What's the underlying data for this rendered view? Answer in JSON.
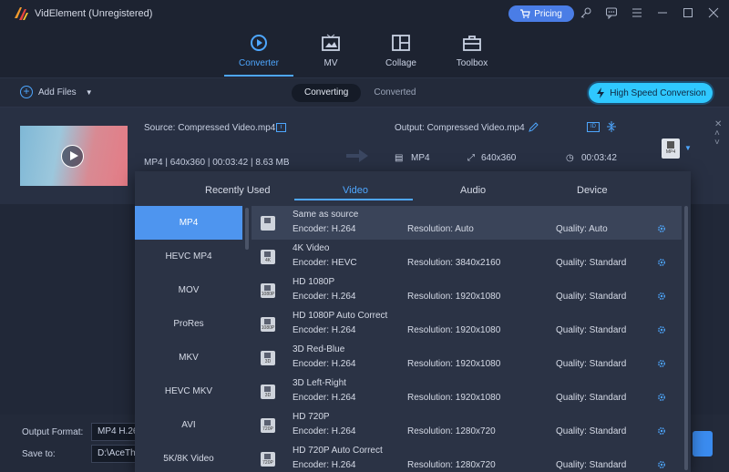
{
  "app": {
    "title": "VidElement (Unregistered)",
    "pricing_label": "Pricing"
  },
  "nav": {
    "tabs": [
      {
        "label": "Converter"
      },
      {
        "label": "MV"
      },
      {
        "label": "Collage"
      },
      {
        "label": "Toolbox"
      }
    ]
  },
  "toolbar": {
    "add_files": "Add Files",
    "converting": "Converting",
    "converted": "Converted",
    "hsc": "High Speed Conversion"
  },
  "file": {
    "source": "Source: Compressed Video.mp4",
    "source_meta": "MP4 | 640x360 | 00:03:42 | 8.63 MB",
    "output": "Output: Compressed Video.mp4",
    "out_format": "MP4",
    "out_res": "640x360",
    "out_duration": "00:03:42",
    "format_thumb": "MP4"
  },
  "panel": {
    "tabs": [
      "Recently Used",
      "Video",
      "Audio",
      "Device"
    ],
    "formats": [
      "MP4",
      "HEVC MP4",
      "MOV",
      "ProRes",
      "MKV",
      "HEVC MKV",
      "AVI",
      "5K/8K Video"
    ],
    "presets": [
      {
        "name": "Same as source",
        "encoder": "Encoder: H.264",
        "res": "Resolution: Auto",
        "quality": "Quality: Auto",
        "tag": ""
      },
      {
        "name": "4K Video",
        "encoder": "Encoder: HEVC",
        "res": "Resolution: 3840x2160",
        "quality": "Quality: Standard",
        "tag": "4K"
      },
      {
        "name": "HD 1080P",
        "encoder": "Encoder: H.264",
        "res": "Resolution: 1920x1080",
        "quality": "Quality: Standard",
        "tag": "1080P"
      },
      {
        "name": "HD 1080P Auto Correct",
        "encoder": "Encoder: H.264",
        "res": "Resolution: 1920x1080",
        "quality": "Quality: Standard",
        "tag": "1080P"
      },
      {
        "name": "3D Red-Blue",
        "encoder": "Encoder: H.264",
        "res": "Resolution: 1920x1080",
        "quality": "Quality: Standard",
        "tag": "3D"
      },
      {
        "name": "3D Left-Right",
        "encoder": "Encoder: H.264",
        "res": "Resolution: 1920x1080",
        "quality": "Quality: Standard",
        "tag": "3D"
      },
      {
        "name": "HD 720P",
        "encoder": "Encoder: H.264",
        "res": "Resolution: 1280x720",
        "quality": "Quality: Standard",
        "tag": "720P"
      },
      {
        "name": "HD 720P Auto Correct",
        "encoder": "Encoder: H.264",
        "res": "Resolution: 1280x720",
        "quality": "Quality: Standard",
        "tag": "720P"
      }
    ]
  },
  "bottom": {
    "output_format_label": "Output Format:",
    "output_format_value": "MP4 H.26",
    "save_to_label": "Save to:",
    "save_to_value": "D:\\AceThi"
  },
  "colors": {
    "accent": "#4ea7ff",
    "selected": "#4e95ef",
    "hsc": "#2fc8ff",
    "pricing": "#4a7de6"
  }
}
